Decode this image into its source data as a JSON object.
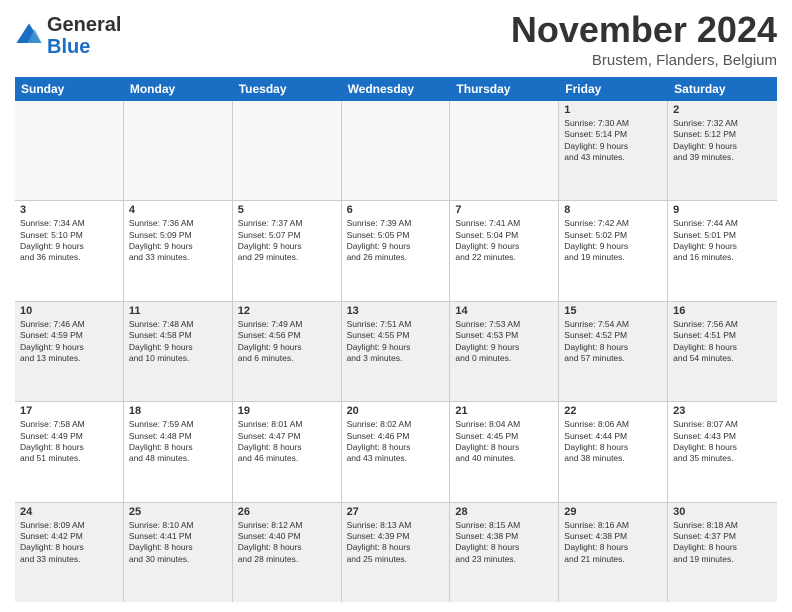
{
  "header": {
    "logo_line1": "General",
    "logo_line2": "Blue",
    "month_title": "November 2024",
    "location": "Brustem, Flanders, Belgium"
  },
  "weekdays": [
    "Sunday",
    "Monday",
    "Tuesday",
    "Wednesday",
    "Thursday",
    "Friday",
    "Saturday"
  ],
  "weeks": [
    [
      {
        "day": "",
        "info": "",
        "empty": true
      },
      {
        "day": "",
        "info": "",
        "empty": true
      },
      {
        "day": "",
        "info": "",
        "empty": true
      },
      {
        "day": "",
        "info": "",
        "empty": true
      },
      {
        "day": "",
        "info": "",
        "empty": true
      },
      {
        "day": "1",
        "info": "Sunrise: 7:30 AM\nSunset: 5:14 PM\nDaylight: 9 hours\nand 43 minutes."
      },
      {
        "day": "2",
        "info": "Sunrise: 7:32 AM\nSunset: 5:12 PM\nDaylight: 9 hours\nand 39 minutes."
      }
    ],
    [
      {
        "day": "3",
        "info": "Sunrise: 7:34 AM\nSunset: 5:10 PM\nDaylight: 9 hours\nand 36 minutes."
      },
      {
        "day": "4",
        "info": "Sunrise: 7:36 AM\nSunset: 5:09 PM\nDaylight: 9 hours\nand 33 minutes."
      },
      {
        "day": "5",
        "info": "Sunrise: 7:37 AM\nSunset: 5:07 PM\nDaylight: 9 hours\nand 29 minutes."
      },
      {
        "day": "6",
        "info": "Sunrise: 7:39 AM\nSunset: 5:05 PM\nDaylight: 9 hours\nand 26 minutes."
      },
      {
        "day": "7",
        "info": "Sunrise: 7:41 AM\nSunset: 5:04 PM\nDaylight: 9 hours\nand 22 minutes."
      },
      {
        "day": "8",
        "info": "Sunrise: 7:42 AM\nSunset: 5:02 PM\nDaylight: 9 hours\nand 19 minutes."
      },
      {
        "day": "9",
        "info": "Sunrise: 7:44 AM\nSunset: 5:01 PM\nDaylight: 9 hours\nand 16 minutes."
      }
    ],
    [
      {
        "day": "10",
        "info": "Sunrise: 7:46 AM\nSunset: 4:59 PM\nDaylight: 9 hours\nand 13 minutes."
      },
      {
        "day": "11",
        "info": "Sunrise: 7:48 AM\nSunset: 4:58 PM\nDaylight: 9 hours\nand 10 minutes."
      },
      {
        "day": "12",
        "info": "Sunrise: 7:49 AM\nSunset: 4:56 PM\nDaylight: 9 hours\nand 6 minutes."
      },
      {
        "day": "13",
        "info": "Sunrise: 7:51 AM\nSunset: 4:55 PM\nDaylight: 9 hours\nand 3 minutes."
      },
      {
        "day": "14",
        "info": "Sunrise: 7:53 AM\nSunset: 4:53 PM\nDaylight: 9 hours\nand 0 minutes."
      },
      {
        "day": "15",
        "info": "Sunrise: 7:54 AM\nSunset: 4:52 PM\nDaylight: 8 hours\nand 57 minutes."
      },
      {
        "day": "16",
        "info": "Sunrise: 7:56 AM\nSunset: 4:51 PM\nDaylight: 8 hours\nand 54 minutes."
      }
    ],
    [
      {
        "day": "17",
        "info": "Sunrise: 7:58 AM\nSunset: 4:49 PM\nDaylight: 8 hours\nand 51 minutes."
      },
      {
        "day": "18",
        "info": "Sunrise: 7:59 AM\nSunset: 4:48 PM\nDaylight: 8 hours\nand 48 minutes."
      },
      {
        "day": "19",
        "info": "Sunrise: 8:01 AM\nSunset: 4:47 PM\nDaylight: 8 hours\nand 46 minutes."
      },
      {
        "day": "20",
        "info": "Sunrise: 8:02 AM\nSunset: 4:46 PM\nDaylight: 8 hours\nand 43 minutes."
      },
      {
        "day": "21",
        "info": "Sunrise: 8:04 AM\nSunset: 4:45 PM\nDaylight: 8 hours\nand 40 minutes."
      },
      {
        "day": "22",
        "info": "Sunrise: 8:06 AM\nSunset: 4:44 PM\nDaylight: 8 hours\nand 38 minutes."
      },
      {
        "day": "23",
        "info": "Sunrise: 8:07 AM\nSunset: 4:43 PM\nDaylight: 8 hours\nand 35 minutes."
      }
    ],
    [
      {
        "day": "24",
        "info": "Sunrise: 8:09 AM\nSunset: 4:42 PM\nDaylight: 8 hours\nand 33 minutes."
      },
      {
        "day": "25",
        "info": "Sunrise: 8:10 AM\nSunset: 4:41 PM\nDaylight: 8 hours\nand 30 minutes."
      },
      {
        "day": "26",
        "info": "Sunrise: 8:12 AM\nSunset: 4:40 PM\nDaylight: 8 hours\nand 28 minutes."
      },
      {
        "day": "27",
        "info": "Sunrise: 8:13 AM\nSunset: 4:39 PM\nDaylight: 8 hours\nand 25 minutes."
      },
      {
        "day": "28",
        "info": "Sunrise: 8:15 AM\nSunset: 4:38 PM\nDaylight: 8 hours\nand 23 minutes."
      },
      {
        "day": "29",
        "info": "Sunrise: 8:16 AM\nSunset: 4:38 PM\nDaylight: 8 hours\nand 21 minutes."
      },
      {
        "day": "30",
        "info": "Sunrise: 8:18 AM\nSunset: 4:37 PM\nDaylight: 8 hours\nand 19 minutes."
      }
    ]
  ]
}
